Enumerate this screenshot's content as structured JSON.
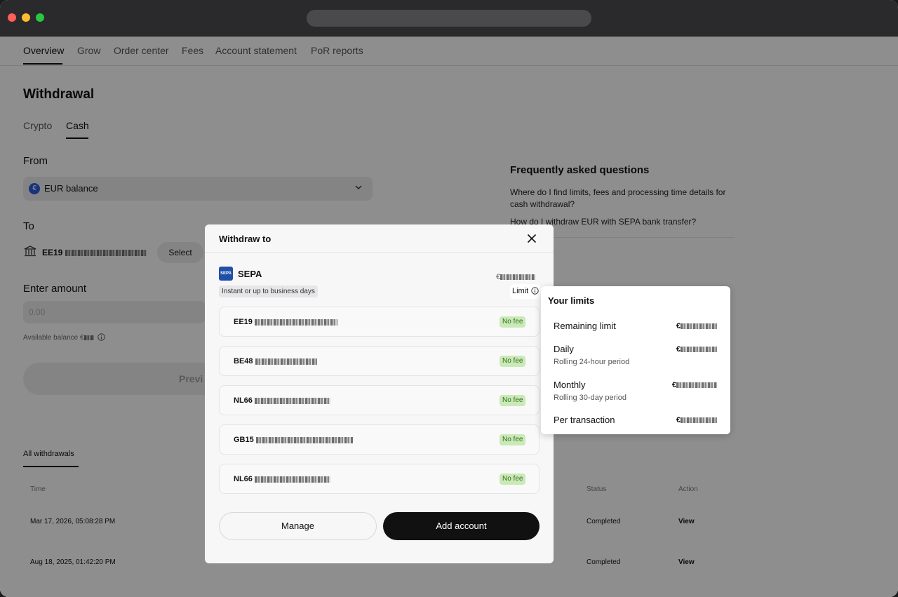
{
  "nav": {
    "items": [
      "Overview",
      "Grow",
      "Order center",
      "Fees",
      "Account statement",
      "PoR reports"
    ]
  },
  "withdrawal": {
    "title": "Withdrawal",
    "tabs": [
      "Crypto",
      "Cash"
    ],
    "from_label": "From",
    "from_value": "EUR balance",
    "euro_symbol": "€",
    "to_label": "To",
    "to_iban_prefix": "EE19",
    "select_label": "Select",
    "amount_label": "Enter amount",
    "amount_placeholder": "0.00",
    "available_prefix": "Available balance €",
    "preview_label": "Previ"
  },
  "history": {
    "tab": "All withdrawals",
    "headers": {
      "time": "Time",
      "status": "Status",
      "action": "Action"
    },
    "rows": [
      {
        "time": "Mar 17, 2026, 05:08:28 PM",
        "status": "Completed",
        "action": "View"
      },
      {
        "time": "Aug 18, 2025, 01:42:20 PM",
        "status": "Completed",
        "action": "View"
      }
    ]
  },
  "faq": {
    "title": "Frequently asked questions",
    "questions": [
      "Where do I find limits, fees and processing time details for cash withdrawal?",
      "How do I withdraw EUR with SEPA bank transfer?"
    ]
  },
  "modal": {
    "title": "Withdraw to",
    "method": {
      "logo_text": "SEPA",
      "name": "SEPA",
      "amount_prefix": "€",
      "badge": "Instant or up to  business days",
      "limit_label": "Limit"
    },
    "accounts": [
      {
        "iban_prefix": "EE19",
        "fee": "No fee"
      },
      {
        "iban_prefix": "BE48",
        "fee": "No fee"
      },
      {
        "iban_prefix": "NL66",
        "fee": "No fee"
      },
      {
        "iban_prefix": "GB15",
        "fee": "No fee"
      },
      {
        "iban_prefix": "NL66",
        "fee": "No fee"
      }
    ],
    "manage_label": "Manage",
    "add_label": "Add account"
  },
  "limits": {
    "title": "Your limits",
    "remaining": {
      "label": "Remaining limit",
      "value_prefix": "€"
    },
    "daily": {
      "label": "Daily",
      "sub": "Rolling 24-hour period",
      "value_prefix": "€"
    },
    "monthly": {
      "label": "Monthly",
      "sub": "Rolling 30-day period",
      "value_prefix": "€"
    },
    "per_tx": {
      "label": "Per transaction",
      "value_prefix": "€"
    }
  }
}
